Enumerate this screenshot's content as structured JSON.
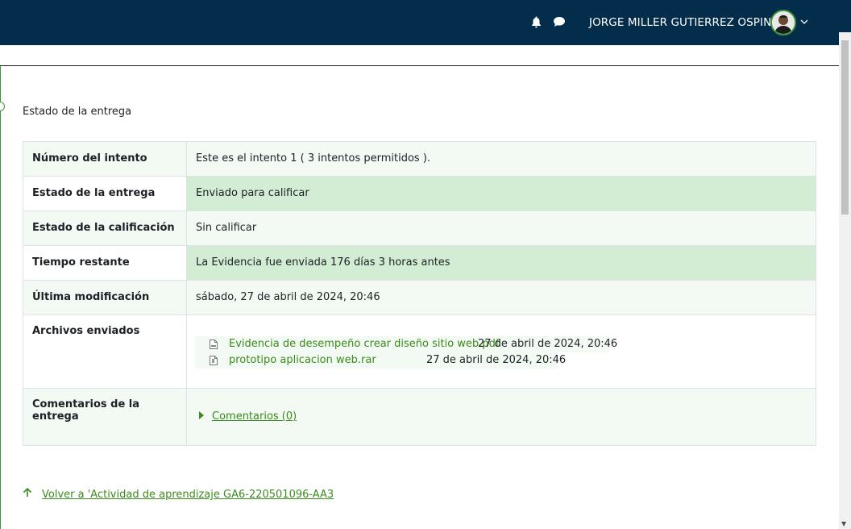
{
  "header": {
    "username": "JORGE MILLER GUTIERREZ OSPINA",
    "icons": [
      "bell-icon",
      "chat-icon",
      "chevron-down-icon"
    ]
  },
  "section": {
    "title": "Estado de la entrega"
  },
  "table": {
    "rows": [
      {
        "label": "Número del intento",
        "value": "Este es el intento 1 ( 3 intentos permitidos )."
      },
      {
        "label": "Estado de la entrega",
        "value": "Enviado para calificar"
      },
      {
        "label": "Estado de la calificación",
        "value": "Sin calificar"
      },
      {
        "label": "Tiempo restante",
        "value": "La Evidencia fue enviada 176 días 3 horas antes"
      },
      {
        "label": "Última modificación",
        "value": "sábado, 27 de abril de 2024, 20:46"
      }
    ],
    "files_label": "Archivos enviados",
    "files": [
      {
        "name": "Evidencia de desempeño crear diseño sitio web.pdf",
        "date": "27 de abril de 2024, 20:46",
        "icon": "pdf-file-icon"
      },
      {
        "name": "prototipo aplicacion web.rar",
        "date": "27 de abril de 2024, 20:46",
        "icon": "archive-file-icon"
      }
    ],
    "comments_label": "Comentarios de la entrega",
    "comments_toggle": "Comentarios (0)"
  },
  "footer": {
    "back_link": "Volver a 'Actividad de aprendizaje GA6-220501096-AA3"
  },
  "colors": {
    "navbar": "#032d4b",
    "accent_green": "#3a8c1c",
    "highlight_row": "#d2edd4",
    "stripe_row": "#f3f9f3"
  }
}
